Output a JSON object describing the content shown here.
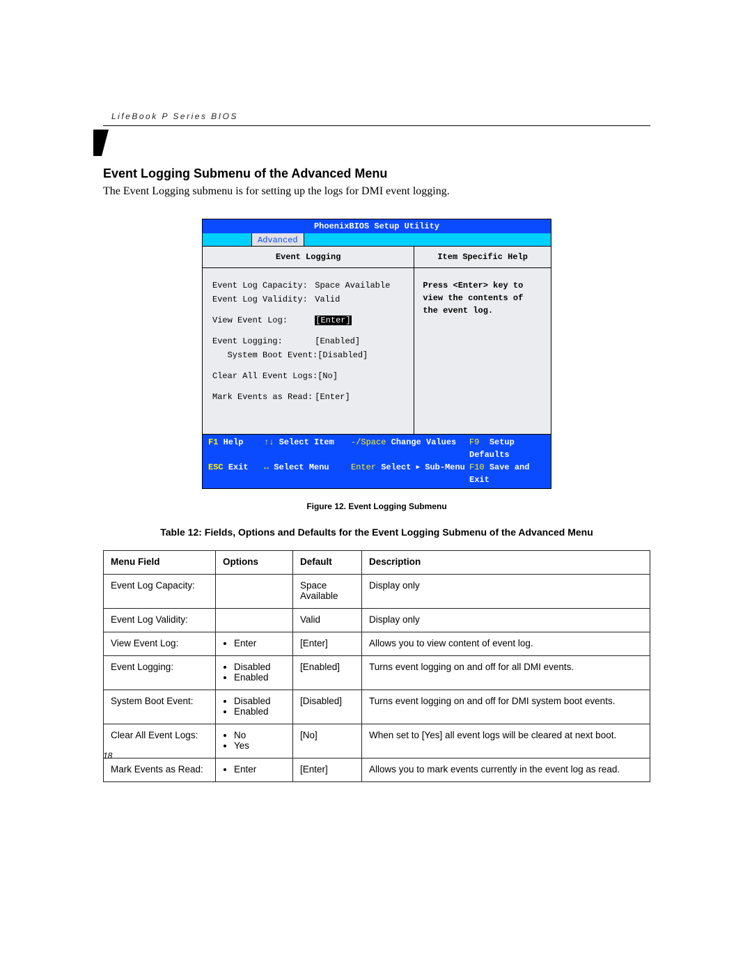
{
  "header": {
    "running_head": "LifeBook P Series BIOS"
  },
  "section": {
    "title": "Event Logging Submenu of the Advanced Menu",
    "intro": "The Event Logging submenu is for setting up the logs for DMI event logging."
  },
  "bios": {
    "title": "PhoenixBIOS Setup Utility",
    "active_tab": "Advanced",
    "left_header": "Event Logging",
    "right_header": "Item Specific Help",
    "help_text": "Press <Enter> key to view the contents of the event log.",
    "rows": [
      {
        "label": "Event Log Capacity:",
        "value": "Space Available",
        "indent": 0,
        "selected": false
      },
      {
        "label": "Event Log Validity:",
        "value": "Valid",
        "indent": 0,
        "selected": false
      },
      {
        "label": "View Event Log:",
        "value": "[Enter]",
        "indent": 0,
        "selected": true,
        "gap": true
      },
      {
        "label": "Event Logging:",
        "value": "[Enabled]",
        "indent": 0,
        "selected": false,
        "gap": true
      },
      {
        "label": "System Boot Event:",
        "value": "[Disabled]",
        "indent": 1,
        "selected": false
      },
      {
        "label": "Clear All Event Logs:",
        "value": "[No]",
        "indent": 0,
        "selected": false,
        "gap": true
      },
      {
        "label": "Mark Events as Read:",
        "value": "[Enter]",
        "indent": 0,
        "selected": false,
        "gap": true
      }
    ],
    "footer": {
      "row1": {
        "k1": "F1",
        "a1": "Help",
        "k2": "↑↓",
        "a2": "Select Item",
        "k3": "-/Space",
        "a3": "Change Values",
        "k4": "F9",
        "a4": "Setup Defaults"
      },
      "row2": {
        "k1": "ESC",
        "a1": "Exit",
        "k2": "↔",
        "a2": "Select Menu",
        "k3": "Enter",
        "a3_pre": "Select ",
        "a3_post": " Sub-Menu",
        "k4": "F10",
        "a4": "Save and Exit"
      }
    }
  },
  "caption": "Figure 12.  Event Logging Submenu",
  "table_title": "Table 12: Fields, Options and Defaults for the Event Logging Submenu of the Advanced Menu",
  "table": {
    "headers": {
      "menu": "Menu Field",
      "options": "Options",
      "default": "Default",
      "desc": "Description"
    },
    "rows": [
      {
        "menu": "Event Log Capacity:",
        "options": [],
        "default": "Space Available",
        "desc": "Display only"
      },
      {
        "menu": "Event Log Validity:",
        "options": [],
        "default": "Valid",
        "desc": "Display only"
      },
      {
        "menu": "View Event Log:",
        "options": [
          "Enter"
        ],
        "default": "[Enter]",
        "desc": "Allows you to view content of event log."
      },
      {
        "menu": "Event Logging:",
        "options": [
          "Disabled",
          "Enabled"
        ],
        "default": "[Enabled]",
        "desc": "Turns event logging on and off for all DMI events."
      },
      {
        "menu": "System Boot Event:",
        "options": [
          "Disabled",
          "Enabled"
        ],
        "default": "[Disabled]",
        "desc": "Turns event logging on and off for DMI system boot events."
      },
      {
        "menu": "Clear All Event Logs:",
        "options": [
          "No",
          "Yes"
        ],
        "default": "[No]",
        "desc": "When set to [Yes] all event logs will be cleared at next boot."
      },
      {
        "menu": "Mark Events as Read:",
        "options": [
          "Enter"
        ],
        "default": "[Enter]",
        "desc": "Allows you to mark events currently in the event log as read."
      }
    ]
  },
  "page_number": "18"
}
